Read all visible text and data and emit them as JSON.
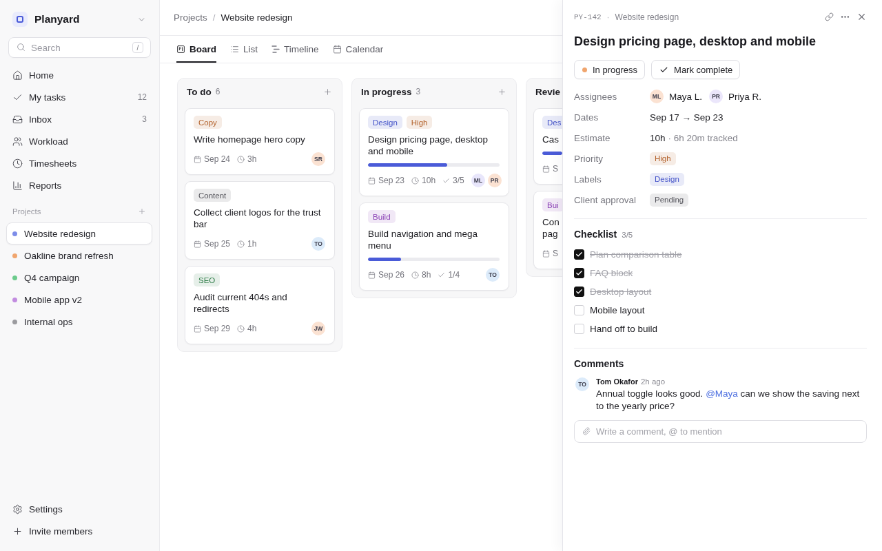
{
  "sidebar": {
    "workspace": "Planyard",
    "search": {
      "placeholder": "Search",
      "shortcut": "/"
    },
    "nav": [
      {
        "kind": "home",
        "label": "Home",
        "selected": false
      },
      {
        "kind": "tasks",
        "label": "My tasks",
        "count": "12",
        "selected": false
      },
      {
        "kind": "inbox",
        "label": "Inbox",
        "count": "3",
        "selected": false
      },
      {
        "kind": "workload",
        "label": "Workload",
        "selected": false
      },
      {
        "kind": "timesheets",
        "label": "Timesheets",
        "selected": false
      },
      {
        "kind": "reports",
        "label": "Reports",
        "selected": false
      }
    ],
    "projects_title": "Projects",
    "projects": [
      {
        "name": "Website redesign",
        "color": "#7d8de9",
        "selected": true
      },
      {
        "name": "Oakline brand refresh",
        "color": "#f0a56e",
        "selected": false
      },
      {
        "name": "Q4 campaign",
        "color": "#6ccb8c",
        "selected": false
      },
      {
        "name": "Mobile app v2",
        "color": "#c28ce0",
        "selected": false
      },
      {
        "name": "Internal ops",
        "color": "#9b9b9f",
        "selected": false
      }
    ],
    "footer": [
      {
        "kind": "settings",
        "label": "Settings"
      },
      {
        "kind": "invite",
        "label": "Invite members"
      }
    ]
  },
  "breadcrumb": {
    "items": [
      "Projects",
      "Website redesign"
    ],
    "separator": "/"
  },
  "view_tabs": [
    {
      "kind": "board",
      "label": "Board",
      "selected": true
    },
    {
      "kind": "list",
      "label": "List",
      "selected": false
    },
    {
      "kind": "timeline",
      "label": "Timeline",
      "selected": false
    },
    {
      "kind": "calendar",
      "label": "Calendar",
      "selected": false
    }
  ],
  "board": {
    "columns": [
      {
        "name": "To do",
        "count": "6",
        "add_button": true,
        "cards": [
          {
            "tags": [
              {
                "label": "Copy",
                "color": "#b3622c"
              }
            ],
            "title": "Write homepage hero copy",
            "date": "Sep 24",
            "estimate": "3h",
            "assignees": [
              {
                "initials": "SR",
                "color": "#fbe2d2"
              }
            ]
          },
          {
            "tags": [
              {
                "label": "Content",
                "color": "#55555c"
              }
            ],
            "title": "Collect client logos for the trust bar",
            "date": "Sep 25",
            "estimate": "1h",
            "assignees": [
              {
                "initials": "TO",
                "color": "#dcebfa"
              }
            ]
          },
          {
            "tags": [
              {
                "label": "SEO",
                "color": "#2f7d48"
              }
            ],
            "title": "Audit current 404s and redirects",
            "date": "Sep 29",
            "estimate": "4h",
            "assignees": [
              {
                "initials": "JW",
                "color": "#fbe2d2"
              }
            ]
          }
        ]
      },
      {
        "name": "In progress",
        "count": "3",
        "add_button": true,
        "cards": [
          {
            "tags": [
              {
                "label": "Design",
                "color": "#4453c8"
              },
              {
                "label": "High",
                "color": "#b3622c"
              }
            ],
            "title": "Design pricing page, desktop and mobile",
            "progress": {
              "level": 0.6
            },
            "date": "Sep 23",
            "estimate": "10h",
            "subtasks": "3/5",
            "assignees": [
              {
                "initials": "ML",
                "color": "#e8e6fb"
              },
              {
                "initials": "PR",
                "color": "#fbe2d2"
              }
            ]
          },
          {
            "tags": [
              {
                "label": "Build",
                "color": "#8a40b5"
              }
            ],
            "title": "Build navigation and mega menu",
            "progress": {
              "level": 0.25
            },
            "date": "Sep 26",
            "estimate": "8h",
            "subtasks": "1/4",
            "assignees": [
              {
                "initials": "TO",
                "color": "#dcebfa"
              }
            ]
          }
        ]
      },
      {
        "name": "Revie",
        "cards": [
          {
            "tags": [
              {
                "label": "Des",
                "color": "#4453c8"
              }
            ],
            "title": "Cas",
            "progress": {
              "level": 1
            },
            "date": "S"
          },
          {
            "tags": [
              {
                "label": "Bui",
                "color": "#8a40b5"
              }
            ],
            "title": "Con pag",
            "date": "S"
          }
        ]
      }
    ]
  },
  "task_panel": {
    "key": "PY-142",
    "separator": "·",
    "project": "Website redesign",
    "title": "Design pricing page, desktop and mobile",
    "status": {
      "label": "In progress",
      "color": "#f0a56e"
    },
    "complete_label": "Mark complete",
    "fields": [
      {
        "kind": "people",
        "label": "Assignees",
        "people": [
          {
            "initials": "ML",
            "name": "Maya L.",
            "color": "#fbe2d2"
          },
          {
            "initials": "PR",
            "name": "Priya R.",
            "color": "#ebe6fb"
          }
        ]
      },
      {
        "kind": "text",
        "label": "Dates",
        "value": "Sep 17 → Sep 23"
      },
      {
        "kind": "estimate",
        "label": "Estimate",
        "value": "10h",
        "note": "· 6h 20m tracked"
      },
      {
        "kind": "tag",
        "label": "Priority",
        "tag": {
          "label": "High",
          "color": "#b3622c"
        }
      },
      {
        "kind": "tag",
        "label": "Labels",
        "tag": {
          "label": "Design",
          "color": "#4453c8"
        }
      },
      {
        "kind": "tag",
        "label": "Client approval",
        "tag": {
          "label": "Pending",
          "color": "#55555c"
        }
      }
    ],
    "checklist": {
      "title": "Checklist",
      "count": "3/5",
      "items": [
        {
          "label": "Plan comparison table",
          "checked": true
        },
        {
          "label": "FAQ block",
          "checked": true
        },
        {
          "label": "Desktop layout",
          "checked": true
        },
        {
          "label": "Mobile layout",
          "checked": false
        },
        {
          "label": "Hand off to build",
          "checked": false
        }
      ]
    },
    "comments": {
      "title": "Comments",
      "items": [
        {
          "initials": "TO",
          "color": "#dcebfa",
          "author": "Tom Okafor",
          "time": "2h ago",
          "body": [
            {
              "kind": "text",
              "text": "Annual toggle looks good. "
            },
            {
              "kind": "mention",
              "text": "@Maya"
            },
            {
              "kind": "text",
              "text": " can we show the saving next to the yearly price?"
            }
          ]
        }
      ],
      "composer": {
        "placeholder": "Write a comment, @ to mention"
      }
    }
  }
}
